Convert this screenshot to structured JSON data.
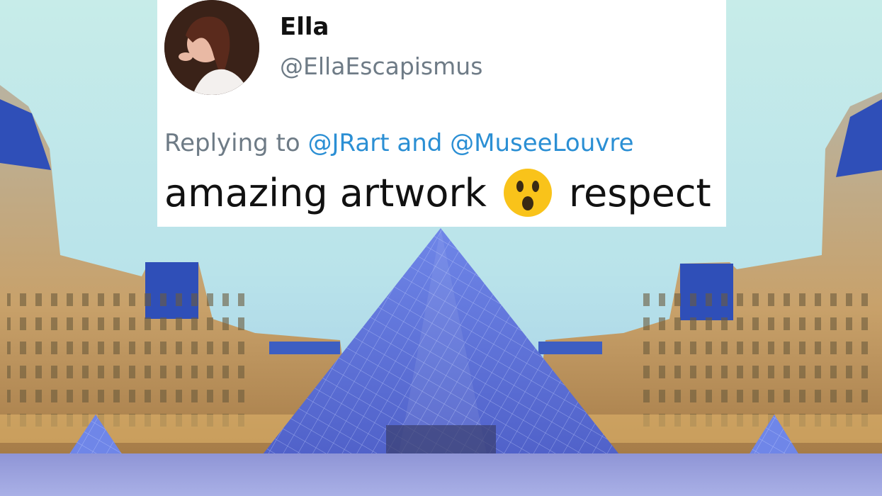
{
  "tweet": {
    "display_name": "Ella",
    "handle": "@EllaEscapismus",
    "replying_to_prefix": "Replying to",
    "mention_1": "@JRart",
    "conjunction": "and",
    "mention_2": "@MuseeLouvre",
    "text_before_emoji": "amazing artwork",
    "emoji": "astonished-face-icon",
    "text_after_emoji": "respect"
  },
  "colors": {
    "mention_blue": "#2b8fd4",
    "secondary_gray": "#6e7b86",
    "sky": "#b9e6e6",
    "pyramid_blue": "#6f7fe0",
    "building_stone": "#c9a774"
  }
}
